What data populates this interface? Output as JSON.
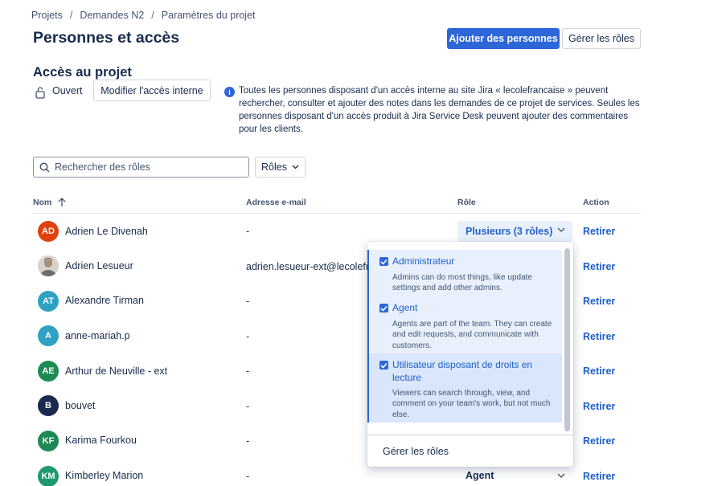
{
  "breadcrumb": [
    "Projets",
    "Demandes N2",
    "Paramètres du projet"
  ],
  "page_title": "Personnes et accès",
  "header_buttons": {
    "add_people": "Ajouter des personnes",
    "manage_roles": "Gérer les rôles"
  },
  "access": {
    "section_title": "Accès au projet",
    "status": "Ouvert",
    "modify_button": "Modifier l'accès interne",
    "info": "Toutes les personnes disposant d'un accès interne au site Jira « lecolefrancaise » peuvent rechercher, consulter et ajouter des notes dans les demandes de ce projet de services. Seules les personnes disposant d'un accès produit à Jira Service Desk peuvent ajouter des commentaires pour les clients."
  },
  "search": {
    "placeholder": "Rechercher des rôles"
  },
  "roles_filter": "Rôles",
  "table": {
    "headers": {
      "name": "Nom",
      "email": "Adresse e-mail",
      "role": "Rôle",
      "action": "Action"
    },
    "rows": [
      {
        "initials": "AD",
        "avatar_color": "#e0420d",
        "name": "Adrien Le Divenah",
        "email": "-",
        "role": "Plusieurs (3 rôles)",
        "action": "Retirer"
      },
      {
        "initials": "",
        "avatar_color": "#b9a793",
        "name": "Adrien Lesueur",
        "email": "adrien.lesueur-ext@lecolefra",
        "role": "",
        "action": "Retirer"
      },
      {
        "initials": "AT",
        "avatar_color": "#2fa2c3",
        "name": "Alexandre Tirman",
        "email": "-",
        "role": "",
        "action": "Retirer"
      },
      {
        "initials": "A",
        "avatar_color": "#2fa2c3",
        "name": "anne-mariah.p",
        "email": "-",
        "role": "",
        "action": "Retirer"
      },
      {
        "initials": "AE",
        "avatar_color": "#1e8a53",
        "name": "Arthur de Neuville - ext",
        "email": "-",
        "role": "",
        "action": "Retirer"
      },
      {
        "initials": "B",
        "avatar_color": "#1b2a4e",
        "name": "bouvet",
        "email": "-",
        "role": "",
        "action": "Retirer"
      },
      {
        "initials": "KF",
        "avatar_color": "#1e8a53",
        "name": "Karima Fourkou",
        "email": "-",
        "role": "",
        "action": "Retirer"
      },
      {
        "initials": "KM",
        "avatar_color": "#1e9a6e",
        "name": "Kimberley Marion",
        "email": "-",
        "role": "Agent",
        "action": "Retirer"
      }
    ]
  },
  "role_dropdown": {
    "options": [
      {
        "label": "Administrateur",
        "desc": "Admins can do most things, like update settings and add other admins.",
        "checked": true
      },
      {
        "label": "Agent",
        "desc": "Agents are part of the team. They can create and edit requests, and communicate with customers.",
        "checked": true
      },
      {
        "label": "Utilisateur disposant de droits en lecture",
        "desc": "Viewers can search through, view, and comment on your team's work, but not much else.",
        "checked": true
      }
    ],
    "footer": "Gérer les rôles"
  }
}
